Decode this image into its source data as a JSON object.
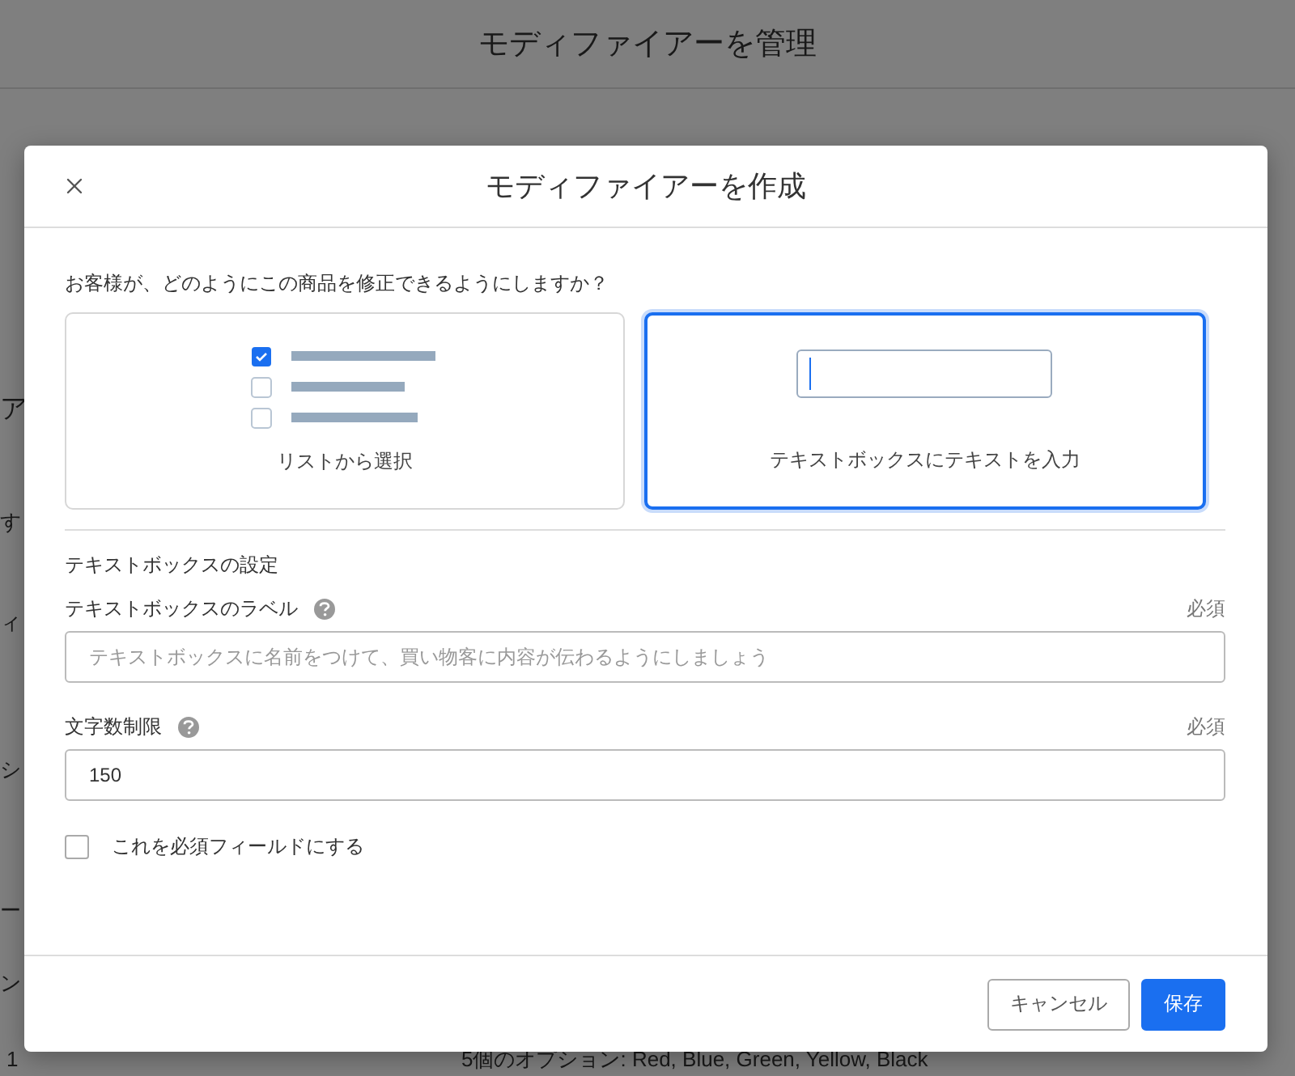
{
  "page": {
    "title": "モディファイアーを管理",
    "fragments": [
      "ア",
      "す",
      "ィ",
      "シ",
      "ー",
      "ン"
    ],
    "table_row": {
      "column_1": "1",
      "column_2": "5個のオプション: Red, Blue, Green, Yellow, Black"
    }
  },
  "dialog": {
    "title": "モディファイアーを作成",
    "question": "お客様が、どのようにこの商品を修正できるようにしますか？",
    "options": [
      {
        "kind": "list",
        "label": "リストから選択",
        "selected": false
      },
      {
        "kind": "textbox",
        "label": "テキストボックスにテキストを入力",
        "selected": true
      }
    ],
    "settings_title": "テキストボックスの設定",
    "fields": [
      {
        "label": "テキストボックスのラベル",
        "required": "必須",
        "placeholder": "テキストボックスに名前をつけて、買い物客に内容が伝わるようにしましょう"
      },
      {
        "label": "文字数制限",
        "required": "必須",
        "value": "150"
      }
    ],
    "required_checkbox": {
      "label": "これを必須フィールドにする",
      "checked": false
    },
    "buttons": [
      {
        "kind": "secondary",
        "label": "キャンセル"
      },
      {
        "kind": "primary",
        "label": "保存"
      }
    ]
  }
}
